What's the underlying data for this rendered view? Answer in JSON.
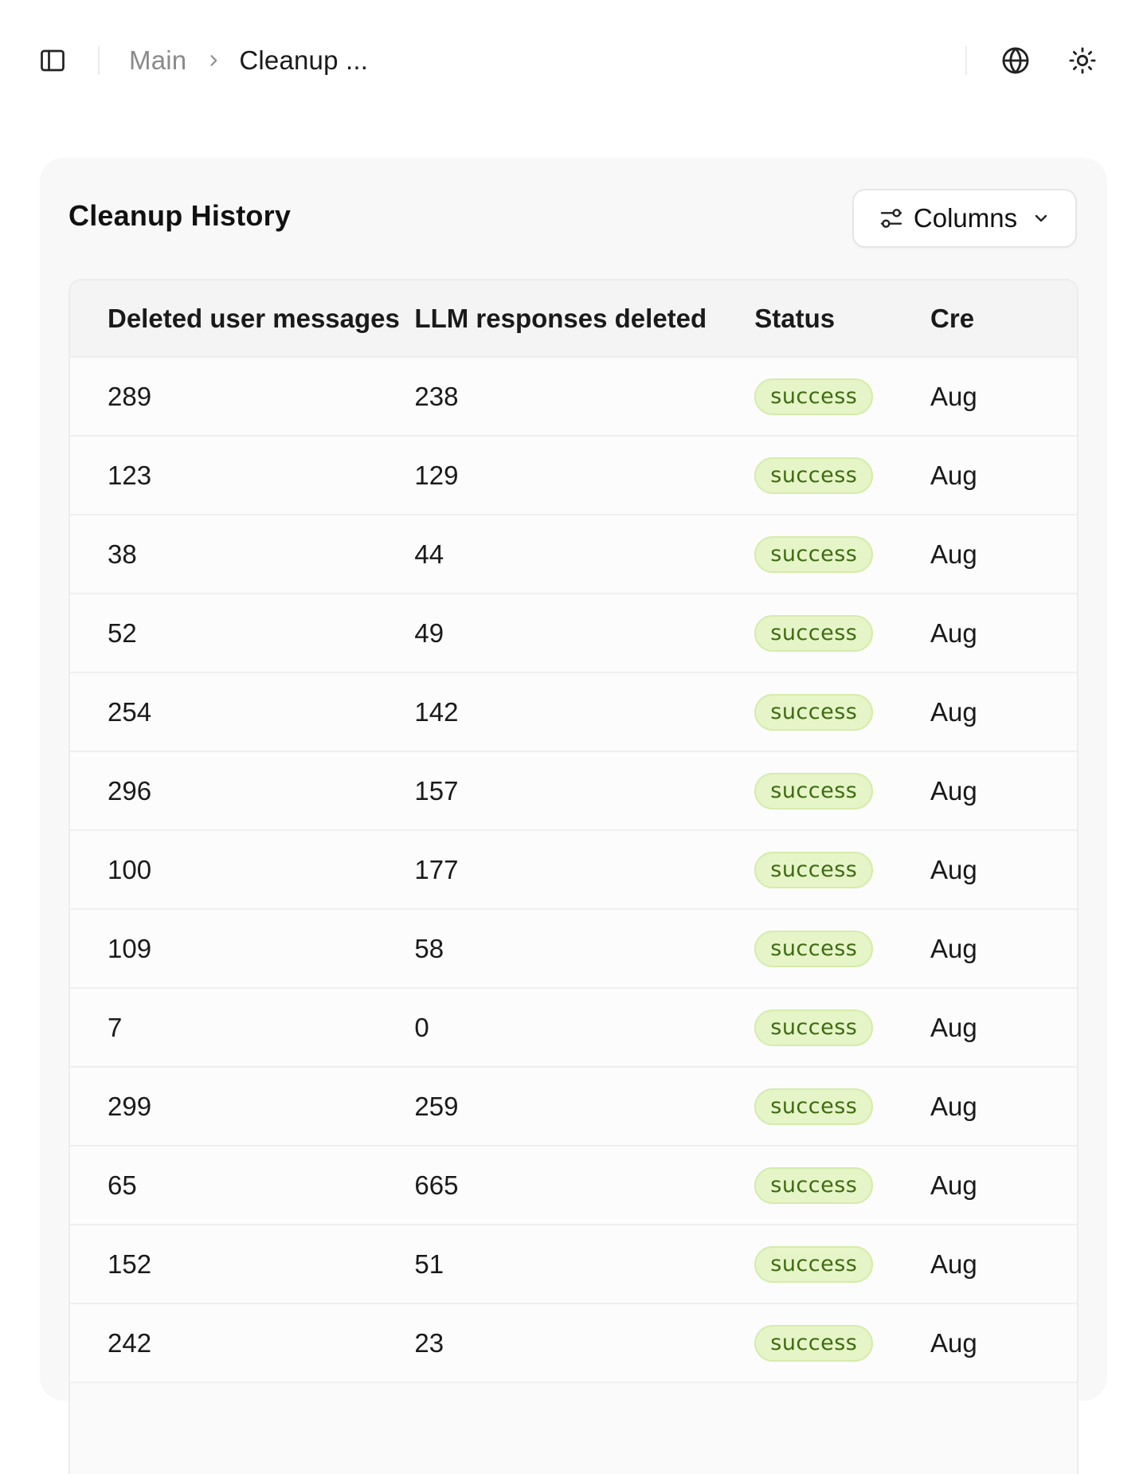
{
  "topbar": {
    "breadcrumb": {
      "parent": "Main",
      "current": "Cleanup ..."
    },
    "icons": {
      "sidebar_toggle": "sidebar-panel-icon",
      "separator": "chevron-right-icon",
      "language": "globe-icon",
      "theme": "sun-icon"
    }
  },
  "card": {
    "title": "Cleanup History",
    "columns_button": {
      "label": "Columns",
      "icon": "sliders-icon",
      "caret": "chevron-down-icon"
    }
  },
  "table": {
    "headers": [
      "Deleted user messages",
      "LLM responses deleted",
      "Status",
      "Cre"
    ],
    "rows": [
      {
        "deleted_user_messages": "289",
        "llm_responses_deleted": "238",
        "status": "success",
        "created": "Aug"
      },
      {
        "deleted_user_messages": "123",
        "llm_responses_deleted": "129",
        "status": "success",
        "created": "Aug"
      },
      {
        "deleted_user_messages": "38",
        "llm_responses_deleted": "44",
        "status": "success",
        "created": "Aug"
      },
      {
        "deleted_user_messages": "52",
        "llm_responses_deleted": "49",
        "status": "success",
        "created": "Aug"
      },
      {
        "deleted_user_messages": "254",
        "llm_responses_deleted": "142",
        "status": "success",
        "created": "Aug"
      },
      {
        "deleted_user_messages": "296",
        "llm_responses_deleted": "157",
        "status": "success",
        "created": "Aug"
      },
      {
        "deleted_user_messages": "100",
        "llm_responses_deleted": "177",
        "status": "success",
        "created": "Aug"
      },
      {
        "deleted_user_messages": "109",
        "llm_responses_deleted": "58",
        "status": "success",
        "created": "Aug"
      },
      {
        "deleted_user_messages": "7",
        "llm_responses_deleted": "0",
        "status": "success",
        "created": "Aug"
      },
      {
        "deleted_user_messages": "299",
        "llm_responses_deleted": "259",
        "status": "success",
        "created": "Aug"
      },
      {
        "deleted_user_messages": "65",
        "llm_responses_deleted": "665",
        "status": "success",
        "created": "Aug"
      },
      {
        "deleted_user_messages": "152",
        "llm_responses_deleted": "51",
        "status": "success",
        "created": "Aug"
      },
      {
        "deleted_user_messages": "242",
        "llm_responses_deleted": "23",
        "status": "success",
        "created": "Aug"
      }
    ]
  },
  "colors": {
    "badge_bg": "#e6f5c7",
    "badge_text": "#3e6b12",
    "card_bg": "#f8f8f8"
  }
}
